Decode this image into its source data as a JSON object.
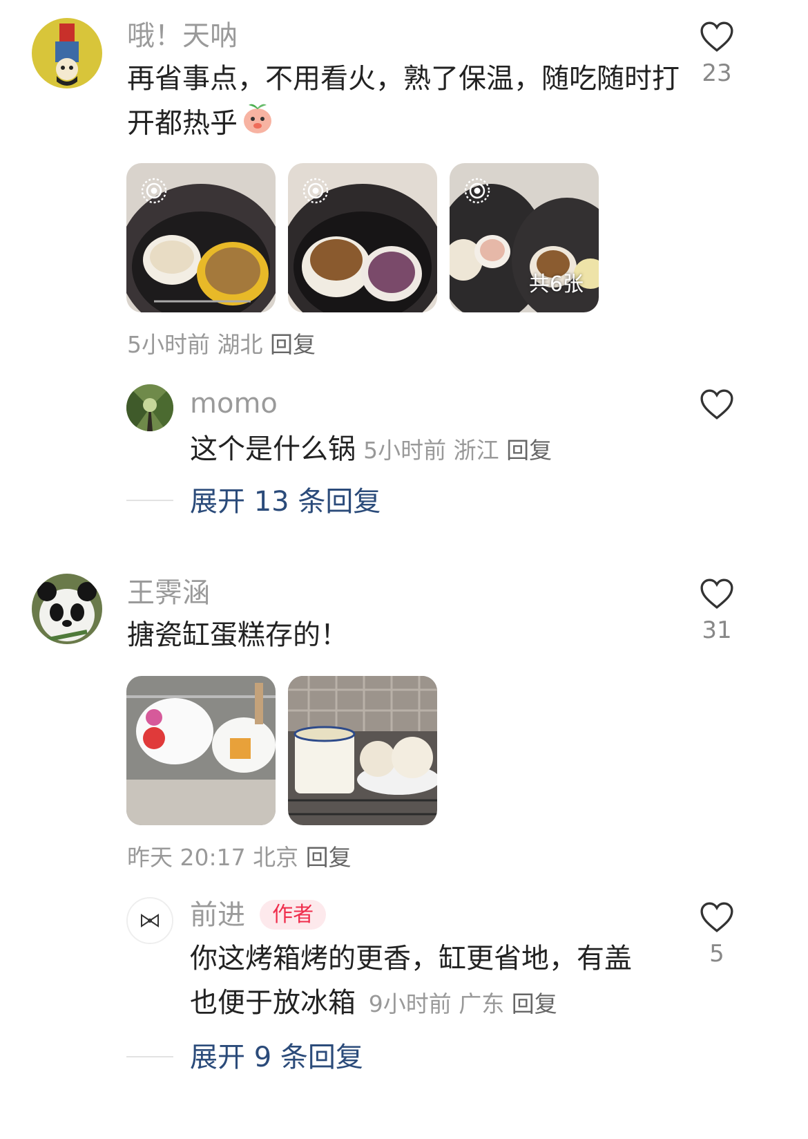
{
  "comments": [
    {
      "username": "哦！天呐",
      "text": "再省事点，不用看火，熟了保温，随吃随时打开都热乎",
      "emoji": "peach-cover-mouth-emoji",
      "likes": "23",
      "images_more_label": "共6张",
      "time": "5小时前",
      "location": "湖北",
      "reply_label": "回复",
      "replies": [
        {
          "username": "momo",
          "text": "这个是什么锅",
          "time": "5小时前",
          "location": "浙江",
          "reply_label": "回复"
        }
      ],
      "expand_label": "展开 13 条回复"
    },
    {
      "username": "王霁涵",
      "text": "搪瓷缸蛋糕存的！",
      "likes": "31",
      "time": "昨天 20:17",
      "location": "北京",
      "reply_label": "回复",
      "replies": [
        {
          "username": "前进",
          "author_tag": "作者",
          "text_line1": "你这烤箱烤的更香，缸更省地，有盖",
          "text_line2": "也便于放冰箱",
          "likes": "5",
          "time": "9小时前",
          "location": "广东",
          "reply_label": "回复"
        }
      ],
      "expand_label": "展开 9 条回复"
    }
  ],
  "icons": {
    "like": "heart-outline-icon",
    "live_photo": "live-photo-icon"
  }
}
